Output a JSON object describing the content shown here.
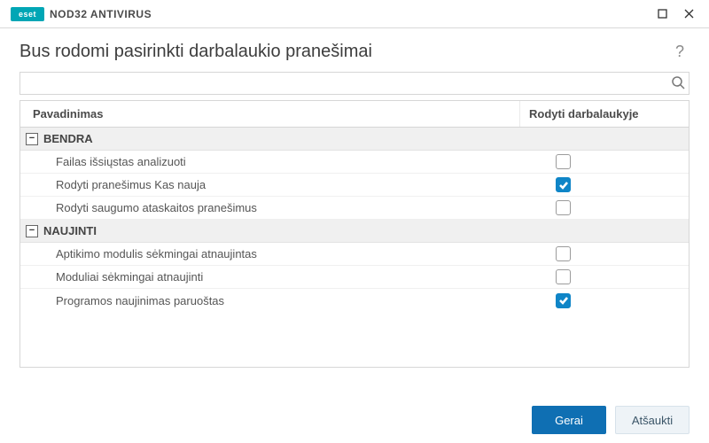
{
  "brand": {
    "logo_text": "eset",
    "product": "NOD32 ANTIVIRUS"
  },
  "window_title": "Bus rodomi pasirinkti darbalaukio pranešimai",
  "help_tooltip": "?",
  "search": {
    "value": ""
  },
  "columns": {
    "name": "Pavadinimas",
    "show": "Rodyti darbalaukyje"
  },
  "groups": [
    {
      "label": "BENDRA",
      "expanded": true,
      "items": [
        {
          "label": "Failas išsiųstas analizuoti",
          "show": false
        },
        {
          "label": "Rodyti pranešimus Kas nauja",
          "show": true
        },
        {
          "label": "Rodyti saugumo ataskaitos pranešimus",
          "show": false
        }
      ]
    },
    {
      "label": "NAUJINTI",
      "expanded": true,
      "items": [
        {
          "label": "Aptikimo modulis sėkmingai atnaujintas",
          "show": false
        },
        {
          "label": "Moduliai sėkmingai atnaujinti",
          "show": false
        },
        {
          "label": "Programos naujinimas paruoštas",
          "show": true
        }
      ]
    }
  ],
  "buttons": {
    "ok": "Gerai",
    "cancel": "Atšaukti"
  }
}
